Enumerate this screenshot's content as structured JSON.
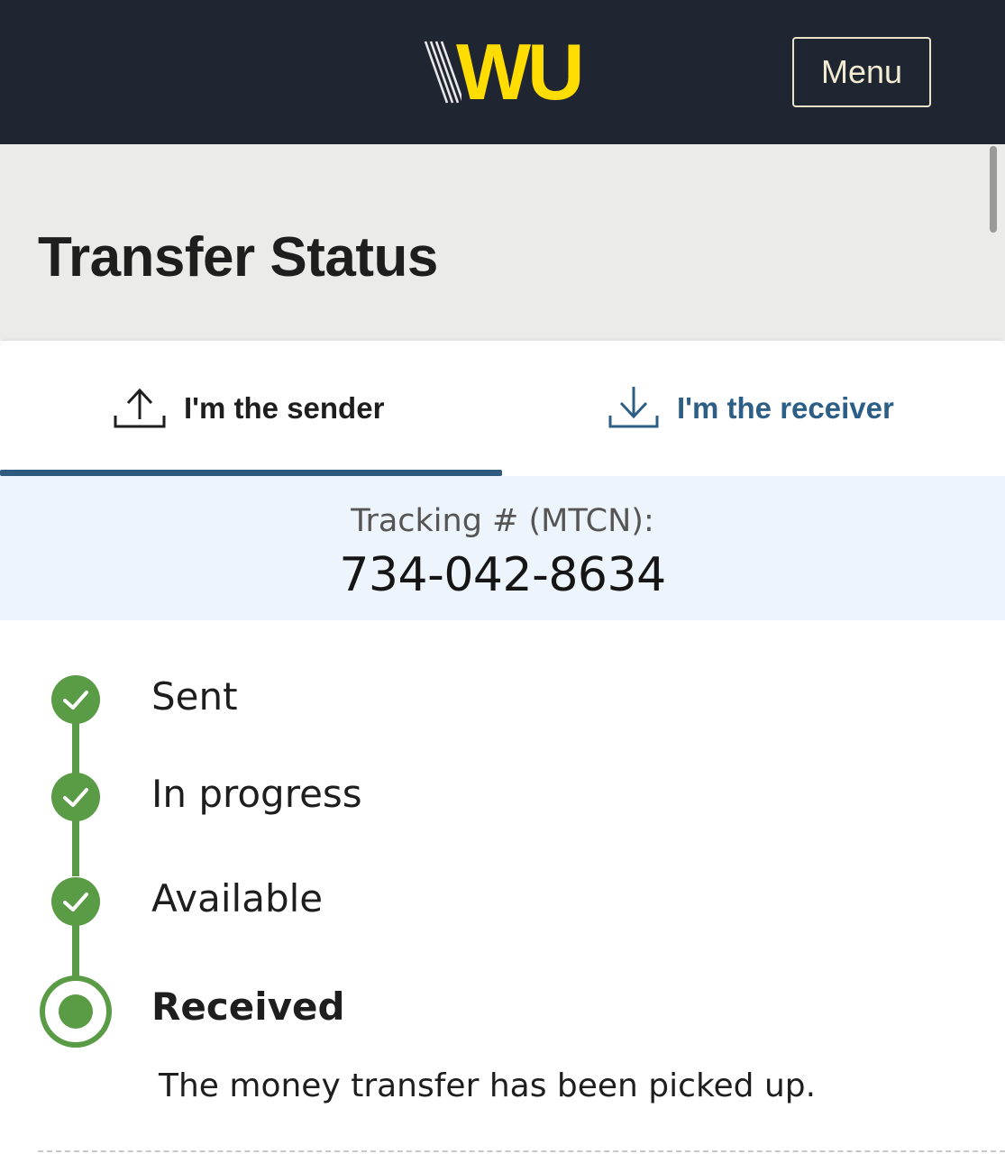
{
  "header": {
    "logo_text": "WU",
    "menu_label": "Menu",
    "colors": {
      "background": "#1f2631",
      "logo": "#ffdd00",
      "logo_stripes": "#e8e8e8"
    }
  },
  "page": {
    "title": "Transfer Status"
  },
  "tabs": [
    {
      "label": "I'm the sender",
      "icon": "upload-icon",
      "selected": true
    },
    {
      "label": "I'm the receiver",
      "icon": "download-icon",
      "selected": false
    }
  ],
  "tracking": {
    "label": "Tracking # (MTCN):",
    "number": "734-042-8634"
  },
  "status_steps": [
    {
      "label": "Sent",
      "state": "complete",
      "icon": "check-circle-icon"
    },
    {
      "label": "In progress",
      "state": "complete",
      "icon": "check-circle-icon"
    },
    {
      "label": "Available",
      "state": "complete",
      "icon": "check-circle-icon"
    },
    {
      "label": "Received",
      "state": "current",
      "icon": "radio-dot-icon"
    }
  ],
  "status_message": "The money transfer has been picked up.",
  "colors": {
    "accent_green": "#5a9c46",
    "tab_underline": "#2d5a7e",
    "receiver_text": "#2d5f86"
  }
}
